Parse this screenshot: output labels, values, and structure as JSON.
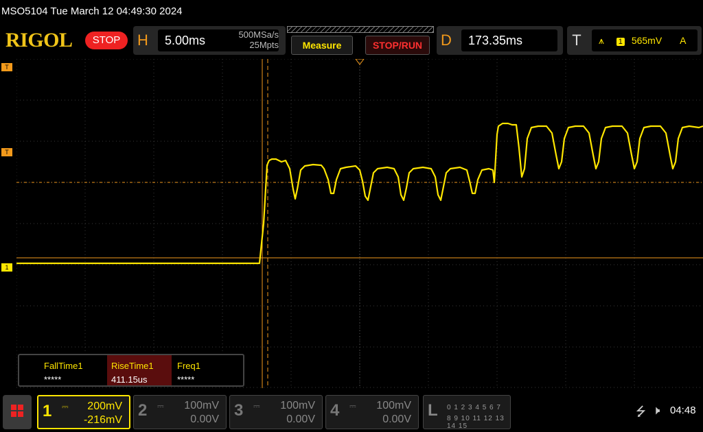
{
  "status": {
    "text": "MSO5104  Tue March 12 04:49:30 2024"
  },
  "header": {
    "logo": "RIGOL",
    "run_state": "STOP",
    "horizontal": {
      "letter": "H",
      "timebase": "5.00ms",
      "sample_rate": "500MSa/s",
      "memory_depth": "25Mpts"
    },
    "measure_button": "Measure",
    "stoprun_button": "STOP/RUN",
    "delay": {
      "letter": "D",
      "value": "173.35ms"
    },
    "trigger": {
      "letter": "T",
      "source": "1",
      "level": "565mV",
      "mode": "A"
    }
  },
  "markers": {
    "trigger_top": "T",
    "trigger_level": "T",
    "channel1": "1"
  },
  "measurements": [
    {
      "name": "FallTime1",
      "value": "*****",
      "selected": false
    },
    {
      "name": "RiseTime1",
      "value": "411.15us",
      "selected": true
    },
    {
      "name": "Freq1",
      "value": "*****",
      "selected": false
    }
  ],
  "channels": [
    {
      "number": "1",
      "scale": "200mV",
      "offset": "-216mV",
      "active": true
    },
    {
      "number": "2",
      "scale": "100mV",
      "offset": "0.00V",
      "active": false
    },
    {
      "number": "3",
      "scale": "100mV",
      "offset": "0.00V",
      "active": false
    },
    {
      "number": "4",
      "scale": "100mV",
      "offset": "0.00V",
      "active": false
    }
  ],
  "logic": {
    "letter": "L",
    "row1": "0 1 2 3  4 5 6 7",
    "row2": "8 9 10 11 12 13 14 15"
  },
  "clock": "04:48",
  "colors": {
    "ch1": "#ffe600",
    "accent": "#f39a1b",
    "stop": "#ee2222"
  },
  "icons": {
    "usb": "usb-icon",
    "speaker": "speaker-mute-icon",
    "menu": "menu-grid-icon"
  }
}
